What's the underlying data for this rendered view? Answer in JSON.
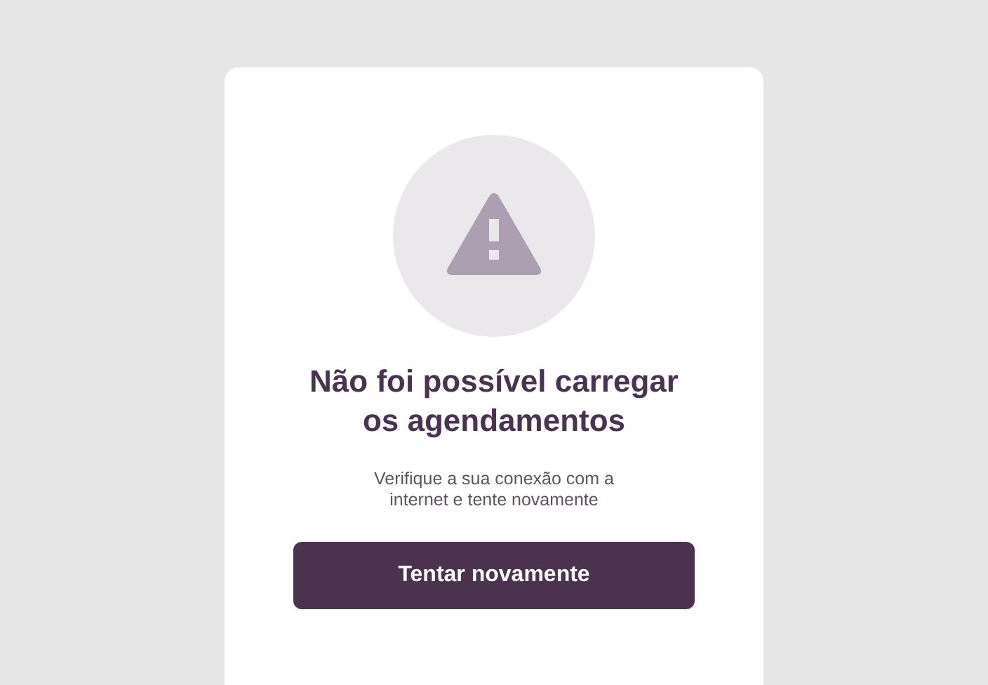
{
  "error_card": {
    "title": "Não foi possível carregar os agendamentos",
    "message": "Verifique a sua conexão com a internet e tente novamente",
    "button": "Tentar novamente"
  }
}
